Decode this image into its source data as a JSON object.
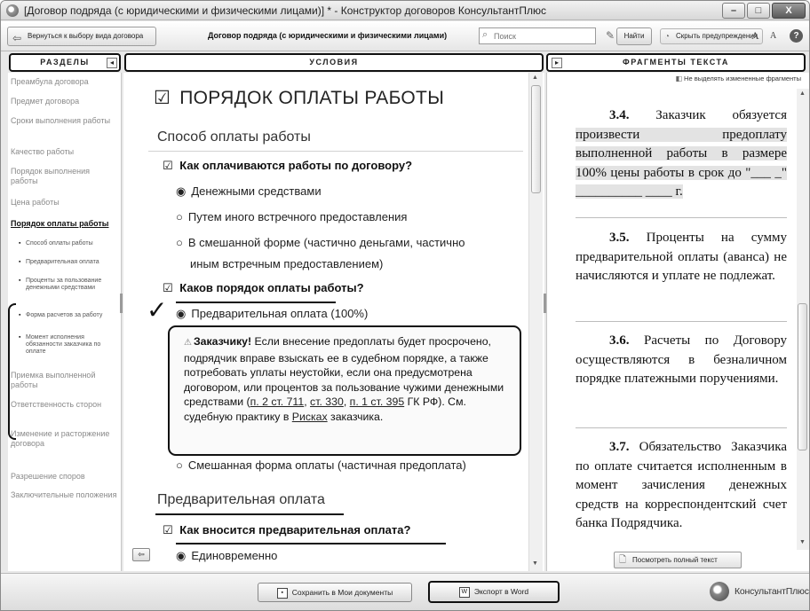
{
  "window": {
    "title": "[Договор подряда (с юридическими и физическими лицами)] * - Конструктор договоров КонсультантПлюс",
    "min_label": "–",
    "max_label": "□",
    "close_label": "X"
  },
  "toolbar": {
    "back_label": "Вернуться к выбору вида договора",
    "doc_title": "Договор подряда (с юридическими и физическими лицами)",
    "search_placeholder": "Поиск",
    "find_label": "Найти",
    "hide_warnings_label": "Скрыть предупреждения",
    "font_up": "A",
    "font_down": "A",
    "help": "?"
  },
  "headers": {
    "sections": "РАЗДЕЛЫ",
    "terms": "УСЛОВИЯ",
    "fragments": "ФРАГМЕНТЫ ТЕКСТА",
    "collapse": "◂",
    "expand": "▸"
  },
  "sidebar": {
    "items": [
      {
        "label": "Преамбула договора"
      },
      {
        "label": "Предмет договора"
      },
      {
        "label": "Сроки выполнения работы"
      },
      {
        "label": "Качество работы"
      },
      {
        "label": "Порядок выполнения работы"
      },
      {
        "label": "Цена работы"
      },
      {
        "label": "Порядок оплаты работы"
      },
      {
        "label": "Приемка выполненной работы"
      },
      {
        "label": "Ответственность сторон"
      },
      {
        "label": "Изменение и расторжение договора"
      },
      {
        "label": "Разрешение споров"
      },
      {
        "label": "Заключительные положения"
      }
    ],
    "subitems": [
      {
        "label": "Способ оплаты работы"
      },
      {
        "label": "Предварительная оплата"
      },
      {
        "label": "Проценты за пользование денежными средствами"
      },
      {
        "label": "Форма расчетов за работу"
      },
      {
        "label": "Момент исполнения обязанности заказчика по оплате"
      }
    ]
  },
  "center": {
    "main_heading": "ПОРЯДОК ОПЛАТЫ РАБОТЫ",
    "checkbox_mark": "☑",
    "radio_on": "◉",
    "radio_off": "○",
    "section1": "Способ оплаты работы",
    "q1": "Как оплачиваются работы по договору?",
    "q1_options": [
      "Денежными средствами",
      "Путем иного встречного предоставления",
      "В смешанной форме (частично деньгами, частично",
      "иным встречным предоставлением)"
    ],
    "q2": "Каков порядок оплаты работы?",
    "q2_options": [
      "Предварительная оплата (100%)",
      "Смешанная форма оплаты (частичная предоплата)"
    ],
    "checkmark": "✓",
    "warning": {
      "icon": "⚠",
      "lead": "Заказчику!",
      "text1": " Если внесение предоплаты будет просрочено, подрядчик вправе взыскать ее в судебном порядке, а также потребовать уплаты неустойки, если она предусмотрена договором, или процентов за пользование чужими денежными средствами (",
      "link1": "п. 2 ст. 711",
      "sep1": ", ",
      "link2": "ст. 330",
      "sep2": ", ",
      "link3": "п. 1 ст. 395",
      "text2": " ГК РФ). См. судебную практику в ",
      "link4": "Рисках",
      "text3": " заказчика."
    },
    "section2": "Предварительная оплата",
    "q3": "Как вносится предварительная оплата?",
    "q3_options": [
      "Единовременно"
    ],
    "back_arrow": "⇦"
  },
  "right": {
    "dont_highlight_label": "Не выделять измененные фрагменты",
    "fragments": [
      {
        "num": "3.4.",
        "text": " Заказчик обязуется ",
        "hl": "произвести предоплату выполненной работы в размере 100% цены работы в срок до \"___ _\" __________ ____ г."
      },
      {
        "num": "3.5.",
        "text": " Проценты на сумму предварительной оплаты (аванса) не начисляются и уплате не подлежат."
      },
      {
        "num": "3.6.",
        "text": " Расчеты по Договору осуществляются в безналичном порядке платежными поручениями."
      },
      {
        "num": "3.7.",
        "text": " Обязательство Заказчика по оплате считается исполненным в момент зачисления денежных средств на корреспондентский счет банка Подрядчика."
      }
    ],
    "full_text_label": "Посмотреть полный текст"
  },
  "bottom": {
    "save_label": "Сохранить в Мои документы",
    "export_label": "Экспорт в Word",
    "brand": "КонсультантПлюс"
  }
}
